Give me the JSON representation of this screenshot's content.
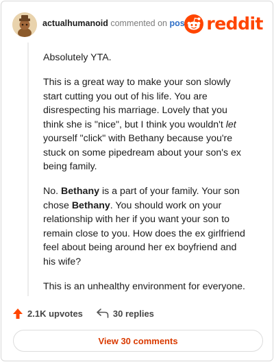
{
  "comment": {
    "username": "actualhumanoid",
    "action_text": "commented on",
    "post_link": "post",
    "brand": {
      "wordmark": "reddit",
      "color": "#ff4500"
    },
    "paragraphs": [
      [
        {
          "t": "Absolutely YTA."
        }
      ],
      [
        {
          "t": "This is a great way to make your son slowly start cutting you out of his life. You are disrespecting his marriage. Lovely that you think she is \"nice\", but I think you wouldn't "
        },
        {
          "t": "let",
          "style": "italic"
        },
        {
          "t": " yourself \"click\" with Bethany because you're stuck on some pipedream about your son's ex being family."
        }
      ],
      [
        {
          "t": "No. "
        },
        {
          "t": "Bethany",
          "style": "bold"
        },
        {
          "t": " is a part of your family. Your son chose "
        },
        {
          "t": "Bethany",
          "style": "bold"
        },
        {
          "t": ". You should work on your relationship with her if you want your son to remain close to you. How does the ex girlfriend feel about being around her ex boyfriend and his wife?"
        }
      ],
      [
        {
          "t": "This is an unhealthy environment for everyone."
        }
      ]
    ]
  },
  "actions": {
    "upvotes": "2.1K upvotes",
    "replies": "30 replies",
    "upvote_icon": "arrow-up-icon",
    "reply_icon": "reply-arrow-icon",
    "upvote_color": "#ff4500"
  },
  "view_button": {
    "label": "View 30 comments",
    "color": "#d93a00"
  }
}
